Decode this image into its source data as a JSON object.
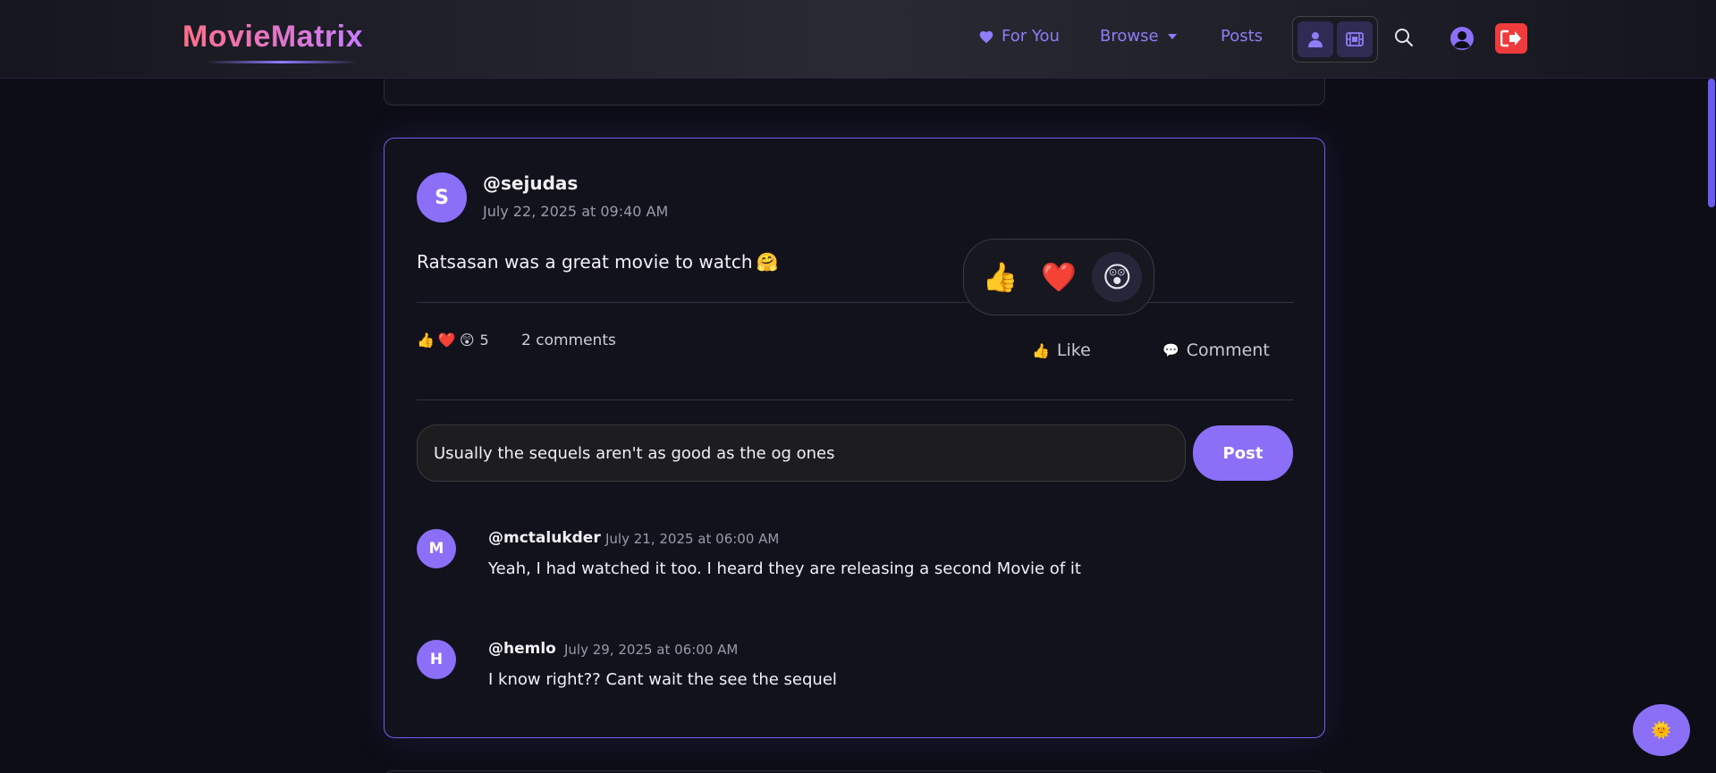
{
  "app": {
    "logo": "MovieMatrix"
  },
  "nav": {
    "for_you": "For You",
    "browse": "Browse",
    "posts": "Posts"
  },
  "post": {
    "avatar_letter": "S",
    "username": "@sejudas",
    "timestamp": "July 22, 2025 at 09:40 AM",
    "content": "Ratsasan was a great movie to watch",
    "content_emoji": "🤗",
    "reaction_summary": {
      "emojis": [
        "👍",
        "❤️",
        "😲"
      ],
      "count": "5"
    },
    "comments_count": "2 comments",
    "like_label": "Like",
    "comment_label": "Comment",
    "reaction_picker": {
      "options": [
        "👍",
        "❤️",
        "😲"
      ],
      "active_index": 2
    },
    "comment_input_value": "Usually the sequels aren't as good as the og ones",
    "post_button": "Post"
  },
  "comments": [
    {
      "avatar_letter": "M",
      "username": "@mctalukder",
      "timestamp": "July 21, 2025 at 06:00 AM",
      "text": "Yeah, I had watched it too. I heard they are releasing a second Movie of it"
    },
    {
      "avatar_letter": "H",
      "username": "@hemlo",
      "timestamp": "July 29, 2025 at 06:00 AM",
      "text": "I know right?? Cant wait the see the sequel"
    }
  ],
  "fab_icon": "sun-icon",
  "colors": {
    "accent": "#8b6ff6",
    "logout": "#ef3b3b",
    "card_border": "#6e5ef2"
  }
}
